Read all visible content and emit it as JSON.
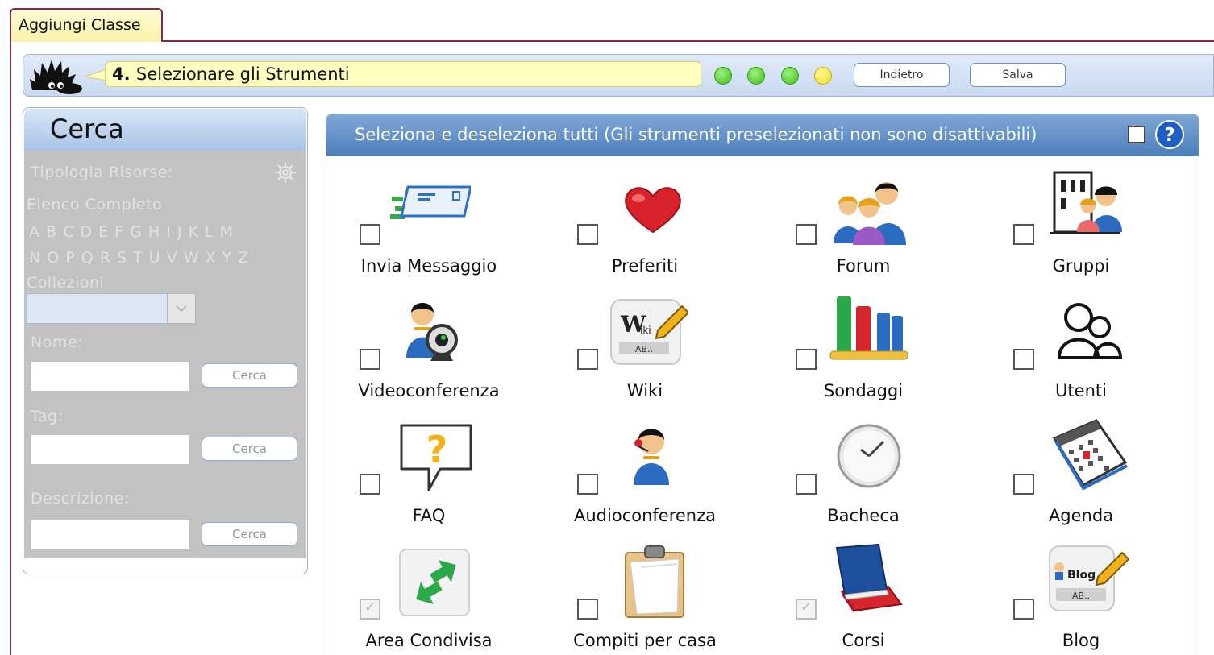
{
  "tab": {
    "label": "Aggiungi Classe"
  },
  "stepbar": {
    "step_number": "4.",
    "step_label": "Selezionare gli Strumenti",
    "dots": [
      "green",
      "green",
      "green",
      "yellow"
    ],
    "back_label": "Indietro",
    "save_label": "Salva"
  },
  "search": {
    "title": "Cerca",
    "tipologia_label": "Tipologia Risorse:",
    "elenco_label": "Elenco Completo",
    "alphabet_row1": "A B C D E F G H I  J   K L M",
    "alphabet_row2": "N O P Q R S T U V W X Y Z",
    "collezioni_label": "Collezioni",
    "nome_label": "Nome:",
    "tag_label": "Tag:",
    "descrizione_label": "Descrizione:",
    "cerca_button": "Cerca"
  },
  "tools": {
    "header_label": "Seleziona e deseleziona tutti (Gli strumenti preselezionati non sono disattivabili)",
    "items": [
      {
        "label": "Invia Messaggio",
        "icon": "send-message-icon",
        "checked": false
      },
      {
        "label": "Preferiti",
        "icon": "heart-icon",
        "checked": false
      },
      {
        "label": "Forum",
        "icon": "forum-people-icon",
        "checked": false
      },
      {
        "label": "Gruppi",
        "icon": "groups-building-icon",
        "checked": false
      },
      {
        "label": "Videoconferenza",
        "icon": "webcam-user-icon",
        "checked": false
      },
      {
        "label": "Wiki",
        "icon": "wiki-pencil-icon",
        "checked": false
      },
      {
        "label": "Sondaggi",
        "icon": "bar-chart-icon",
        "checked": false
      },
      {
        "label": "Utenti",
        "icon": "users-outline-icon",
        "checked": false
      },
      {
        "label": "FAQ",
        "icon": "question-bubble-icon",
        "checked": false
      },
      {
        "label": "Audioconferenza",
        "icon": "headset-user-icon",
        "checked": false
      },
      {
        "label": "Bacheca",
        "icon": "clock-icon",
        "checked": false
      },
      {
        "label": "Agenda",
        "icon": "calendar-icon",
        "checked": false
      },
      {
        "label": "Area Condivisa",
        "icon": "shared-arrows-icon",
        "checked": true
      },
      {
        "label": "Compiti per casa",
        "icon": "clipboard-icon",
        "checked": false
      },
      {
        "label": "Corsi",
        "icon": "books-icon",
        "checked": true
      },
      {
        "label": "Blog",
        "icon": "blog-pencil-icon",
        "checked": false
      }
    ]
  },
  "colors": {
    "frame": "#7a2a55",
    "header_blue": "#4d7fbc",
    "step_yellow": "#ffffc0"
  }
}
